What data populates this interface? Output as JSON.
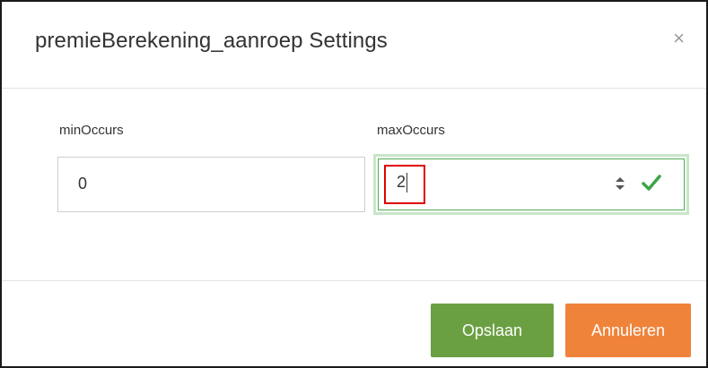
{
  "dialog": {
    "title": "premieBerekening_aanroep Settings",
    "close_symbol": "×"
  },
  "fields": {
    "min": {
      "label": "minOccurs",
      "value": "0"
    },
    "max": {
      "label": "maxOccurs",
      "value": "2"
    }
  },
  "icons": {
    "spinner": "spinner-updown-icon",
    "valid": "checkmark-icon",
    "close": "close-icon"
  },
  "buttons": {
    "save_label": "Opslaan",
    "cancel_label": "Annuleren"
  },
  "colors": {
    "save": "#6aa042",
    "cancel": "#f0833a",
    "valid_border": "#4caf50",
    "highlight": "#e00000"
  }
}
